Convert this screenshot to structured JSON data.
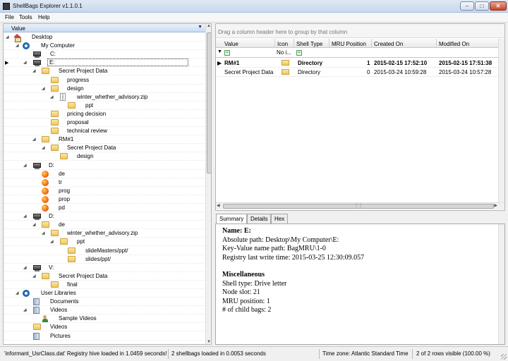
{
  "window": {
    "title": "ShellBags Explorer v1.1.0.1"
  },
  "menu": {
    "file": "File",
    "tools": "Tools",
    "help": "Help"
  },
  "tree": {
    "header": "Value",
    "rows": [
      {
        "label": "Desktop",
        "icon": "home-icon"
      },
      {
        "label": "My Computer",
        "icon": "gear-icon"
      },
      {
        "label": "C:",
        "icon": "drive-icon"
      },
      {
        "label": "E:",
        "icon": "drive-icon"
      },
      {
        "label": "Secret Project Data",
        "icon": "folder-icon"
      },
      {
        "label": "progress",
        "icon": "folder-icon"
      },
      {
        "label": "design",
        "icon": "folder-icon"
      },
      {
        "label": "winter_whether_advisory.zip",
        "icon": "zip-icon"
      },
      {
        "label": "ppt",
        "icon": "folder-icon"
      },
      {
        "label": "pricing decision",
        "icon": "folder-icon"
      },
      {
        "label": "proposal",
        "icon": "folder-icon"
      },
      {
        "label": "technical review",
        "icon": "folder-icon"
      },
      {
        "label": "RM#1",
        "icon": "folder-icon"
      },
      {
        "label": "Secret Project Data",
        "icon": "folder-icon"
      },
      {
        "label": "design",
        "icon": "folder-icon"
      },
      {
        "label": "D:",
        "icon": "drive-icon"
      },
      {
        "label": "de",
        "icon": "firefox-icon"
      },
      {
        "label": "tr",
        "icon": "firefox-icon"
      },
      {
        "label": "prog",
        "icon": "firefox-icon"
      },
      {
        "label": "prop",
        "icon": "firefox-icon"
      },
      {
        "label": "pd",
        "icon": "firefox-icon"
      },
      {
        "label": "D:",
        "icon": "drive-icon"
      },
      {
        "label": "de",
        "icon": "folder-icon"
      },
      {
        "label": "winter_whether_advisory.zip",
        "icon": "folder-icon"
      },
      {
        "label": "ppt",
        "icon": "folder-icon"
      },
      {
        "label": "slideMasters/ppt/",
        "icon": "folder-icon"
      },
      {
        "label": "slides/ppt/",
        "icon": "folder-icon"
      },
      {
        "label": "V:",
        "icon": "drive-icon"
      },
      {
        "label": "Secret Project Data",
        "icon": "folder-icon"
      },
      {
        "label": "final",
        "icon": "folder-icon"
      },
      {
        "label": "User Libraries",
        "icon": "gear-icon"
      },
      {
        "label": "Documents",
        "icon": "library-icon"
      },
      {
        "label": "Videos",
        "icon": "library-icon"
      },
      {
        "label": "Sample Videos",
        "icon": "user-icon"
      },
      {
        "label": "Videos",
        "icon": "folder-icon"
      },
      {
        "label": "Pictures",
        "icon": "library-icon"
      }
    ]
  },
  "grid": {
    "group_hint": "Drag a column header here to group by that column",
    "columns": [
      "Value",
      "Icon",
      "Shell Type",
      "MRU Position",
      "Created On",
      "Modified On"
    ],
    "filter_icon_text": "No i...",
    "rows": [
      {
        "value": "RM#1",
        "shell_type": "Directory",
        "mru": "1",
        "created": "2015-02-15 17:52:10",
        "modified": "2015-02-15 17:51:38"
      },
      {
        "value": "Secret Project Data",
        "shell_type": "Directory",
        "mru": "0",
        "created": "2015-03-24 10:59:28",
        "modified": "2015-03-24 10:57:28"
      }
    ]
  },
  "tabs": [
    "Summary",
    "Details",
    "Hex"
  ],
  "summary": {
    "name": "Name: E:",
    "absolute_path": "Absolute path: Desktop\\My Computer\\E:",
    "key_value": "Key-Value name path: BagMRU\\1-0",
    "last_write": "Registry last write time: 2015-03-25 12:30:09.057",
    "misc_heading": "Miscellaneous",
    "shell_type": "Shell type: Drive letter",
    "node_slot": "Node slot: 21",
    "mru_position": "MRU position: 1",
    "child_bags": "# of child bags: 2"
  },
  "status": {
    "hive": "'informant_UsrClass.dat' Registry hive loaded in 1.0459 seconds!",
    "shellbags": "2 shellbags loaded in 0.0053 seconds",
    "timezone": "Time zone: Atlantic Standard Time",
    "rows_visible": "2 of 2 rows visible (100.00 %)"
  }
}
